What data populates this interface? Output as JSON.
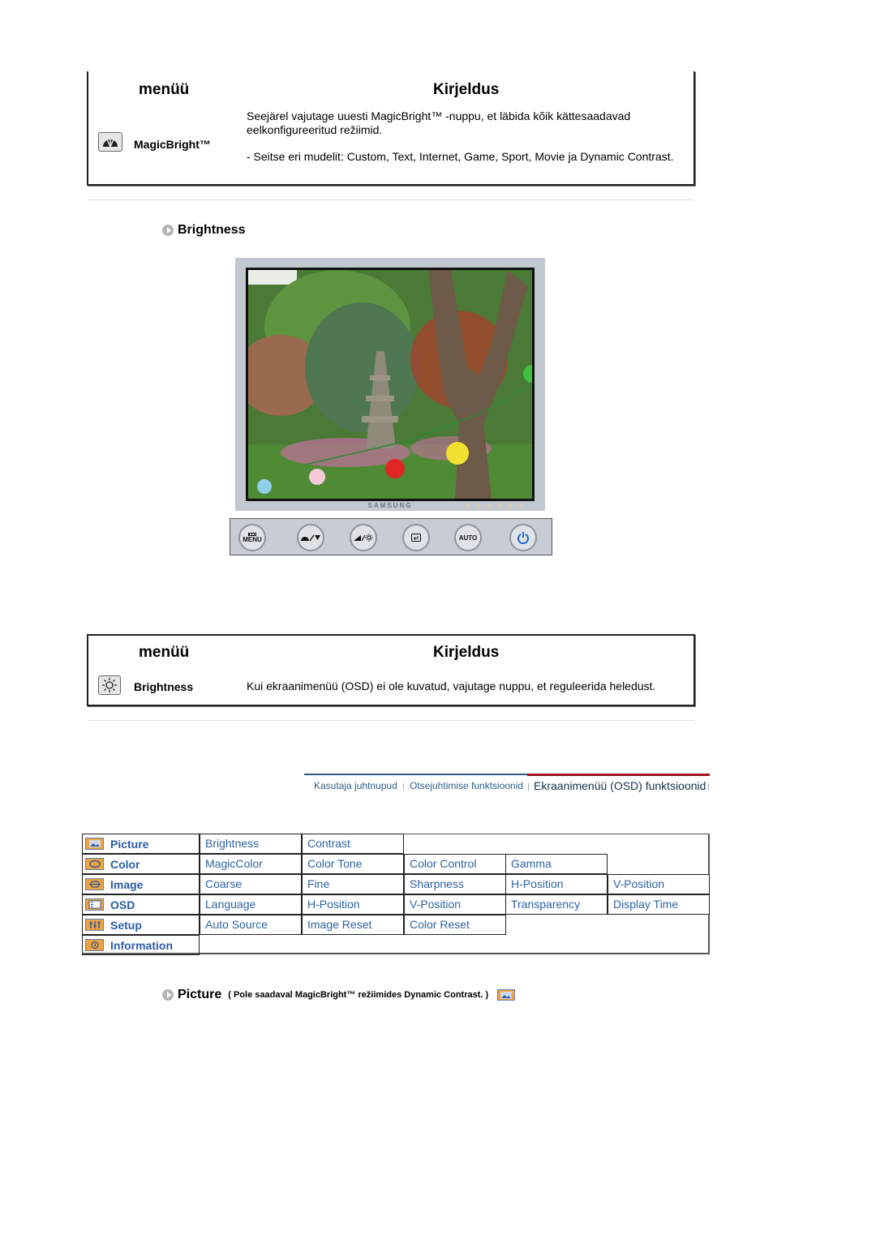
{
  "magicbright_table": {
    "header_menu": "menüü",
    "header_description": "Kirjeldus",
    "item_label": "MagicBright™",
    "item_icon": "magicbright-icon",
    "description_line1": "Seejärel vajutage uuesti MagicBright™ -nuppu, et läbida kõik kättesaadavad eelkonfigureeritud režiimid.",
    "description_line2": "- Seitse eri mudelit: Custom, Text, Internet, Game, Sport, Movie ja Dynamic Contrast."
  },
  "brightness_section": {
    "title": "Brightness",
    "monitor_brand": "SAMSUNG",
    "panel_buttons": [
      {
        "label": "MENU",
        "icon": "menu-icon"
      },
      {
        "label": "",
        "icon": "magicbright-down-icon"
      },
      {
        "label": "",
        "icon": "brightness-up-icon"
      },
      {
        "label": "",
        "icon": "enter-icon"
      },
      {
        "label": "AUTO",
        "icon": "auto-icon"
      },
      {
        "label": "",
        "icon": "power-icon"
      }
    ]
  },
  "brightness_table": {
    "header_menu": "menüü",
    "header_description": "Kirjeldus",
    "item_label": "Brightness",
    "item_icon": "sun-icon",
    "description": "Kui ekraanimenüü (OSD) ei ole kuvatud, vajutage nuppu, et reguleerida heledust."
  },
  "tabs": [
    {
      "label": "Kasutaja juhtnupud",
      "active": false
    },
    {
      "label": "Otsejuhtimise funktsioonid",
      "active": false
    },
    {
      "label": "Ekraanimenüü (OSD) funktsioonid",
      "active": true
    }
  ],
  "osd_menu": [
    {
      "label": "Picture",
      "icon": "picture-icon",
      "items": [
        "Brightness",
        "Contrast"
      ]
    },
    {
      "label": "Color",
      "icon": "color-icon",
      "items": [
        "MagicColor",
        "Color Tone",
        "Color Control",
        "Gamma"
      ]
    },
    {
      "label": "Image",
      "icon": "image-icon",
      "items": [
        "Coarse",
        "Fine",
        "Sharpness",
        "H-Position",
        "V-Position"
      ]
    },
    {
      "label": "OSD",
      "icon": "osd-icon",
      "items": [
        "Language",
        "H-Position",
        "V-Position",
        "Transparency",
        "Display Time"
      ]
    },
    {
      "label": "Setup",
      "icon": "setup-icon",
      "items": [
        "Auto Source",
        "Image Reset",
        "Color Reset"
      ]
    },
    {
      "label": "Information",
      "icon": "information-icon",
      "items": []
    }
  ],
  "picture_note": {
    "title": "Picture",
    "subtitle": "( Pole saadaval MagicBright™ režiimides Dynamic Contrast. )"
  },
  "colors": {
    "link_blue": "#2f62a0",
    "menu_blue": "#2d5ca8",
    "icon_orange": "#f0a23c",
    "active_tab_red": "#a0141e"
  }
}
